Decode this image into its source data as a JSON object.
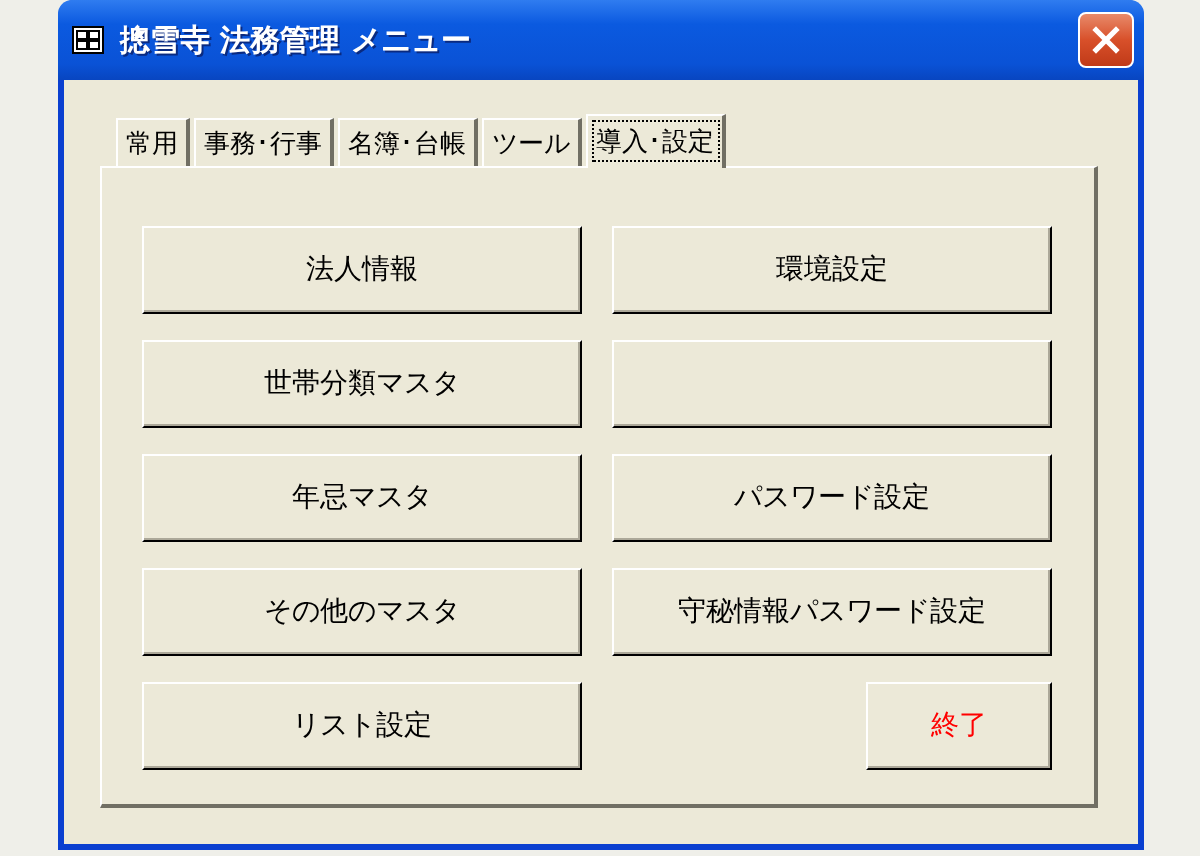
{
  "window": {
    "title": "摠雪寺 法務管理 メニュー"
  },
  "tabs": [
    {
      "label": "常用",
      "selected": false
    },
    {
      "label": "事務･行事",
      "selected": false
    },
    {
      "label": "名簿･台帳",
      "selected": false
    },
    {
      "label": "ツール",
      "selected": false
    },
    {
      "label": "導入･設定",
      "selected": true
    }
  ],
  "buttons": [
    {
      "kind": "normal",
      "label": "法人情報"
    },
    {
      "kind": "normal",
      "label": "環境設定"
    },
    {
      "kind": "normal",
      "label": "世帯分類マスタ"
    },
    {
      "kind": "blank"
    },
    {
      "kind": "normal",
      "label": "年忌マスタ"
    },
    {
      "kind": "normal",
      "label": "パスワード設定"
    },
    {
      "kind": "normal",
      "label": "その他のマスタ"
    },
    {
      "kind": "normal",
      "label": "守秘情報パスワード設定"
    },
    {
      "kind": "normal",
      "label": "リスト設定"
    },
    {
      "kind": "exit",
      "label": "終了"
    }
  ]
}
